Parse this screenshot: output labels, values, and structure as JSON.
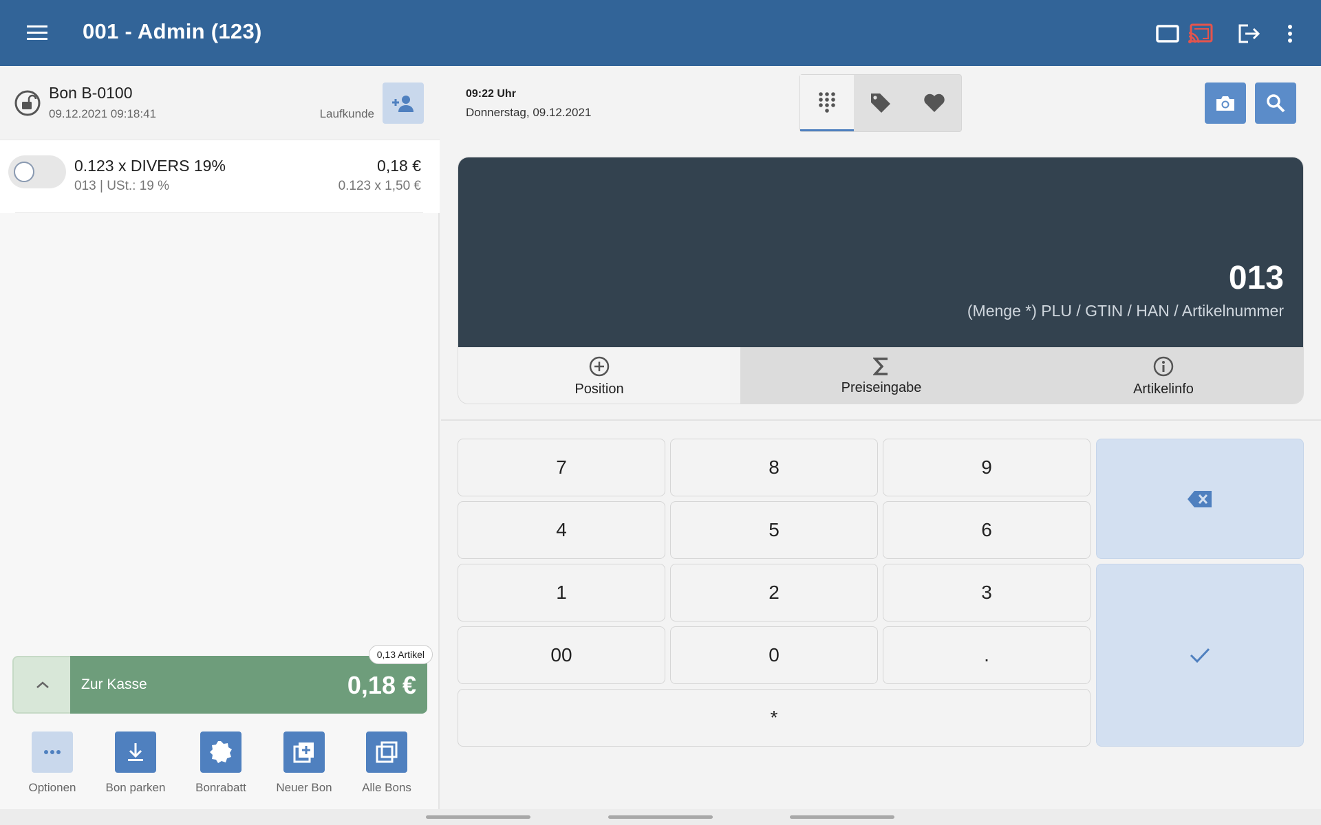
{
  "appbar": {
    "title": "001 - Admin (123)",
    "icons": [
      "menu-icon",
      "display-window-icon",
      "cast-icon",
      "logout-icon",
      "more-vertical-icon"
    ],
    "colors": {
      "bar": "#326498",
      "cast": "#e5544c"
    }
  },
  "bon": {
    "title": "Bon B-0100",
    "datetime": "09.12.2021 09:18:41",
    "customer": "Laufkunde"
  },
  "line_items": [
    {
      "name": "0.123 x DIVERS 19%",
      "sub": "013 | USt.: 19 %",
      "price": "0,18 €",
      "calc": "0.123 x 1,50 €"
    }
  ],
  "checkout": {
    "label": "Zur Kasse",
    "total": "0,18 €",
    "badge": "0,13 Artikel",
    "color": "#6e9d7b"
  },
  "bottom_actions": [
    {
      "label": "Optionen",
      "icon": "more-horizontal-icon"
    },
    {
      "label": "Bon parken",
      "icon": "download-icon"
    },
    {
      "label": "Bonrabatt",
      "icon": "discount-badge-icon"
    },
    {
      "label": "Neuer Bon",
      "icon": "add-document-icon"
    },
    {
      "label": "Alle Bons",
      "icon": "stack-icon"
    }
  ],
  "clock": {
    "time": "09:22 Uhr",
    "date": "Donnerstag, 09.12.2021"
  },
  "segments": [
    {
      "icon": "dialpad-icon",
      "active": true
    },
    {
      "icon": "tag-icon",
      "active": false
    },
    {
      "icon": "heart-icon",
      "active": false
    }
  ],
  "tools": [
    {
      "icon": "camera-icon"
    },
    {
      "icon": "search-icon"
    }
  ],
  "display": {
    "value": "013",
    "hint": "(Menge *) PLU / GTIN / HAN / Artikelnummer"
  },
  "modes": [
    {
      "label": "Position",
      "icon": "plus-circle-icon",
      "active": true
    },
    {
      "label": "Preiseingabe",
      "icon": "sigma-icon",
      "active": false
    },
    {
      "label": "Artikelinfo",
      "icon": "info-icon",
      "active": false
    }
  ],
  "keypad": {
    "keys": [
      "7",
      "8",
      "9",
      "4",
      "5",
      "6",
      "1",
      "2",
      "3",
      "00",
      "0",
      ".",
      "*"
    ],
    "backspace_icon": "backspace-icon",
    "confirm_icon": "check-icon"
  }
}
